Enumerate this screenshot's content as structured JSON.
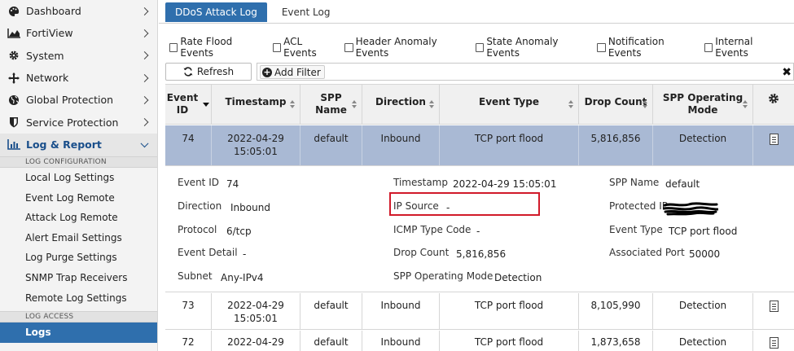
{
  "sidebar": {
    "items": [
      {
        "label": "Dashboard",
        "icon": "palette-icon"
      },
      {
        "label": "FortiView",
        "icon": "chart-area-icon"
      },
      {
        "label": "System",
        "icon": "gear-icon"
      },
      {
        "label": "Network",
        "icon": "network-arrows-icon"
      },
      {
        "label": "Global Protection",
        "icon": "globe-icon"
      },
      {
        "label": "Service Protection",
        "icon": "shield-icon"
      },
      {
        "label": "Log & Report",
        "icon": "bar-chart-icon"
      }
    ],
    "section_config": "LOG CONFIGURATION",
    "config_items": [
      "Local Log Settings",
      "Event Log Remote",
      "Attack Log Remote",
      "Alert Email Settings",
      "Log Purge Settings",
      "SNMP Trap Receivers",
      "Remote Log Settings"
    ],
    "section_access": "LOG ACCESS",
    "access_items": [
      "Logs"
    ]
  },
  "tabs": [
    "DDoS Attack Log",
    "Event Log"
  ],
  "filters": [
    "Rate Flood Events",
    "ACL Events",
    "Header Anomaly Events",
    "State Anomaly Events",
    "Notification Events",
    "Internal Events"
  ],
  "toolbar": {
    "refresh": "Refresh",
    "add_filter": "Add Filter",
    "clear": "✖"
  },
  "table": {
    "headers": {
      "event_id": [
        "Event",
        "ID"
      ],
      "timestamp": "Timestamp",
      "spp_name": [
        "SPP",
        "Name"
      ],
      "direction": "Direction",
      "event_type": "Event Type",
      "drop_count": "Drop Count",
      "spp_mode": [
        "SPP Operating",
        "Mode"
      ]
    },
    "rows": [
      {
        "id": "74",
        "date": "2022-04-29",
        "time": "15:05:01",
        "spp": "default",
        "direction": "Inbound",
        "type": "TCP port flood",
        "drop": "5,816,856",
        "mode": "Detection"
      },
      {
        "id": "73",
        "date": "2022-04-29",
        "time": "15:05:01",
        "spp": "default",
        "direction": "Inbound",
        "type": "TCP port flood",
        "drop": "8,105,990",
        "mode": "Detection"
      },
      {
        "id": "72",
        "date": "2022-04-29",
        "time": "",
        "spp": "default",
        "direction": "Inbound",
        "type": "TCP port flood",
        "drop": "1,873,658",
        "mode": "Detection"
      }
    ]
  },
  "detail": {
    "event_id": {
      "label": "Event ID",
      "value": "74"
    },
    "direction": {
      "label": "Direction",
      "value": "Inbound"
    },
    "protocol": {
      "label": "Protocol",
      "value": "6/tcp"
    },
    "event_detail": {
      "label": "Event Detail",
      "value": "-"
    },
    "subnet": {
      "label": "Subnet",
      "value": "Any-IPv4"
    },
    "timestamp": {
      "label": "Timestamp",
      "value": "2022-04-29 15:05:01"
    },
    "ip_source": {
      "label": "IP Source",
      "value": "-"
    },
    "icmp": {
      "label": "ICMP Type Code",
      "value": "-"
    },
    "drop_count": {
      "label": "Drop Count",
      "value": "5,816,856"
    },
    "spp_mode": {
      "label": "SPP Operating Mode",
      "value": "Detection"
    },
    "spp_name": {
      "label": "SPP Name",
      "value": "default"
    },
    "protected_ip": {
      "label": "Protected IP",
      "value": ""
    },
    "event_type": {
      "label": "Event Type",
      "value": "TCP port flood"
    },
    "assoc_port": {
      "label": "Associated Port",
      "value": "50000"
    }
  },
  "colors": {
    "accent": "#2f6fad",
    "selected_row": "#a9b9d4",
    "highlight": "#d11a2a"
  }
}
